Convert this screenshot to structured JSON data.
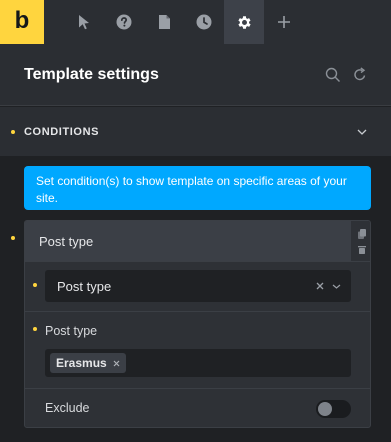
{
  "colors": {
    "accent": "#ffd53e",
    "info": "#00a8ff",
    "panel": "#2b2e33",
    "background": "#1f2124"
  },
  "toolbar": {
    "logo": "b",
    "tabs": [
      {
        "icon": "cursor-icon",
        "active": false
      },
      {
        "icon": "help-icon",
        "active": false
      },
      {
        "icon": "page-icon",
        "active": false
      },
      {
        "icon": "clock-icon",
        "active": false
      },
      {
        "icon": "gear-icon",
        "active": true
      },
      {
        "icon": "plus-icon",
        "active": false
      }
    ]
  },
  "header": {
    "title": "Template settings",
    "icons": [
      "search-icon",
      "reset-icon"
    ]
  },
  "section": {
    "title": "CONDITIONS",
    "expanded": true
  },
  "info_banner": {
    "text": "Set condition(s) to show template on specific areas of your site."
  },
  "condition": {
    "title": "Post type",
    "main_select": {
      "value": "Post type"
    },
    "post_type": {
      "label": "Post type",
      "tags": [
        "Erasmus"
      ]
    },
    "exclude": {
      "label": "Exclude",
      "enabled": false
    }
  }
}
